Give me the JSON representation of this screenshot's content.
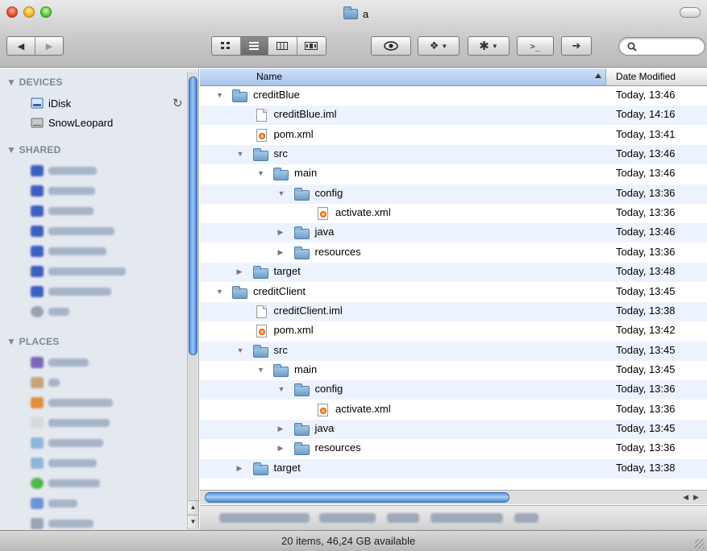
{
  "window": {
    "title": "a"
  },
  "toolbar": {
    "search_placeholder": "",
    "action_glyph": ">_",
    "forward_glyph": "➔"
  },
  "sidebar": {
    "devices_label": "DEVICES",
    "shared_label": "SHARED",
    "places_label": "PLACES",
    "devices": [
      {
        "label": "iDisk"
      },
      {
        "label": "SnowLeopard"
      }
    ]
  },
  "list": {
    "col_name": "Name",
    "col_date": "Date Modified",
    "rows": [
      {
        "name": "creditBlue",
        "date": "Today, 13:46"
      },
      {
        "name": "creditBlue.iml",
        "date": "Today, 14:16"
      },
      {
        "name": "pom.xml",
        "date": "Today, 13:41"
      },
      {
        "name": "src",
        "date": "Today, 13:46"
      },
      {
        "name": "main",
        "date": "Today, 13:46"
      },
      {
        "name": "config",
        "date": "Today, 13:36"
      },
      {
        "name": "activate.xml",
        "date": "Today, 13:36"
      },
      {
        "name": "java",
        "date": "Today, 13:46"
      },
      {
        "name": "resources",
        "date": "Today, 13:36"
      },
      {
        "name": "target",
        "date": "Today, 13:48"
      },
      {
        "name": "creditClient",
        "date": "Today, 13:45"
      },
      {
        "name": "creditClient.iml",
        "date": "Today, 13:38"
      },
      {
        "name": "pom.xml",
        "date": "Today, 13:42"
      },
      {
        "name": "src",
        "date": "Today, 13:45"
      },
      {
        "name": "main",
        "date": "Today, 13:45"
      },
      {
        "name": "config",
        "date": "Today, 13:36"
      },
      {
        "name": "activate.xml",
        "date": "Today, 13:36"
      },
      {
        "name": "java",
        "date": "Today, 13:45"
      },
      {
        "name": "resources",
        "date": "Today, 13:36"
      },
      {
        "name": "target",
        "date": "Today, 13:38"
      }
    ]
  },
  "status": {
    "text": "20 items, 46,24 GB available"
  }
}
